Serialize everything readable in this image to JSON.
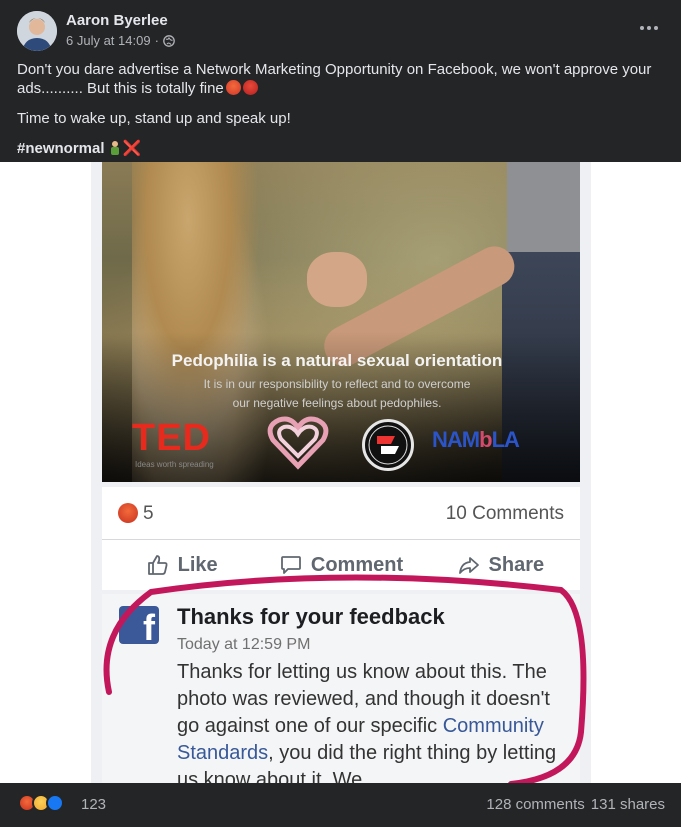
{
  "post": {
    "author": "Aaron Byerlee",
    "date": "6 July at 14:09",
    "separator": "·",
    "privacy_icon": "globe-icon",
    "more_icon": "more-dots-icon",
    "text_line1": "Don't you dare advertise a Network Marketing Opportunity on Facebook, we won't approve your ads.......... But this is totally fine",
    "text_line2": "Time to wake up, stand up and speak up!",
    "hashtag": "#newnormal",
    "redx": "❌"
  },
  "image": {
    "headline": "Pedophilia is a natural sexual orientation",
    "subline1": "It is in our responsibility to reflect and to overcome",
    "subline2": "our negative feelings about pedophiles.",
    "ted": "TED",
    "ted_tag": "Ideas worth spreading",
    "nambla_a": "NAM",
    "nambla_b": "b",
    "nambla_c": "LA",
    "reaction_count": "5",
    "comments_count": "10 Comments",
    "like_label": "Like",
    "comment_label": "Comment",
    "share_label": "Share",
    "feedback_title": "Thanks for your feedback",
    "feedback_time": "Today at 12:59 PM",
    "feedback_body_1": "Thanks for letting us know about this. The photo was reviewed, and though it doesn't go against one of our specific",
    "feedback_link": "Community Standards",
    "feedback_body_2": ", you did the right thing by letting us know about it. We"
  },
  "footer": {
    "reaction_total": "123",
    "comments": "128 comments",
    "shares": "131 shares"
  },
  "colors": {
    "background": "#242526",
    "annotation_circle": "#c2185b",
    "facebook_blue": "#3b5998"
  }
}
